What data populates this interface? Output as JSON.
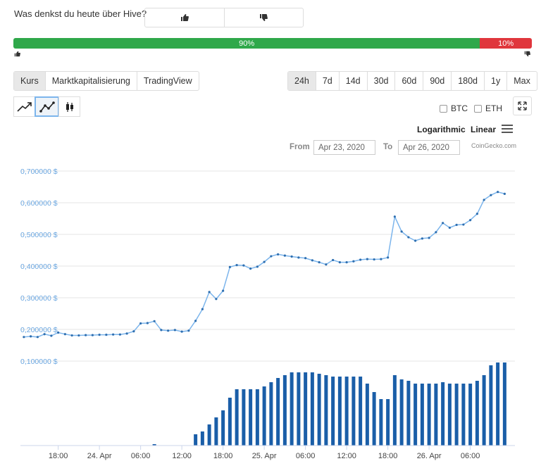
{
  "header": {
    "question": "Was denkst du heute über Hive?",
    "vote_up_icon": "thumbs-up-icon",
    "vote_down_icon": "thumbs-down-icon"
  },
  "sentiment": {
    "up_pct": 90,
    "down_pct": 10,
    "up_label": "90%",
    "down_label": "10%",
    "up_color": "#2fa84a",
    "down_color": "#e0363c"
  },
  "tabs": [
    "Kurs",
    "Marktkapitalisierung",
    "TradingView"
  ],
  "ranges": [
    "24h",
    "7d",
    "14d",
    "30d",
    "60d",
    "90d",
    "180d",
    "1y",
    "Max"
  ],
  "chart_types": [
    "line-chart-icon",
    "line-points-icon",
    "candlestick-icon"
  ],
  "compare": {
    "btc": "BTC",
    "eth": "ETH"
  },
  "scale": {
    "log": "Logarithmic",
    "linear": "Linear"
  },
  "range_inputs": {
    "from_label": "From",
    "to_label": "To",
    "from_value": "Apr 23, 2020",
    "to_value": "Apr 26, 2020"
  },
  "credit": "CoinGecko.com",
  "chart_data": {
    "type": "line",
    "line_color": "#7cb5ec",
    "bar_color": "#1a5ea8",
    "y_ticks": [
      {
        "value": 0.1,
        "label": "0,100000 $"
      },
      {
        "value": 0.2,
        "label": "0,200000 $"
      },
      {
        "value": 0.3,
        "label": "0,300000 $"
      },
      {
        "value": 0.4,
        "label": "0,400000 $"
      },
      {
        "value": 0.5,
        "label": "0,500000 $"
      },
      {
        "value": 0.6,
        "label": "0,600000 $"
      },
      {
        "value": 0.7,
        "label": "0,700000 $"
      }
    ],
    "ylim": [
      0.05,
      0.7
    ],
    "x_ticks": [
      {
        "t": 11,
        "label": "18:00"
      },
      {
        "t": 23,
        "label": "24. Apr"
      },
      {
        "t": 35,
        "label": "06:00"
      },
      {
        "t": 47,
        "label": "12:00"
      },
      {
        "t": 59,
        "label": "18:00"
      },
      {
        "t": 71,
        "label": "25. Apr"
      },
      {
        "t": 83,
        "label": "06:00"
      },
      {
        "t": 95,
        "label": "12:00"
      },
      {
        "t": 107,
        "label": "18:00"
      },
      {
        "t": 119,
        "label": "26. Apr"
      },
      {
        "t": 131,
        "label": "06:00"
      }
    ],
    "x_range": [
      0,
      144
    ],
    "price": [
      [
        1,
        0.176
      ],
      [
        3,
        0.178
      ],
      [
        5,
        0.176
      ],
      [
        7,
        0.185
      ],
      [
        9,
        0.18
      ],
      [
        11,
        0.19
      ],
      [
        13,
        0.185
      ],
      [
        15,
        0.181
      ],
      [
        17,
        0.181
      ],
      [
        19,
        0.182
      ],
      [
        21,
        0.182
      ],
      [
        23,
        0.183
      ],
      [
        25,
        0.183
      ],
      [
        27,
        0.184
      ],
      [
        29,
        0.184
      ],
      [
        31,
        0.187
      ],
      [
        33,
        0.194
      ],
      [
        35,
        0.219
      ],
      [
        37,
        0.22
      ],
      [
        39,
        0.226
      ],
      [
        41,
        0.198
      ],
      [
        43,
        0.196
      ],
      [
        45,
        0.198
      ],
      [
        47,
        0.193
      ],
      [
        49,
        0.196
      ],
      [
        51,
        0.227
      ],
      [
        53,
        0.264
      ],
      [
        55,
        0.318
      ],
      [
        57,
        0.296
      ],
      [
        59,
        0.322
      ],
      [
        61,
        0.397
      ],
      [
        63,
        0.403
      ],
      [
        65,
        0.402
      ],
      [
        67,
        0.392
      ],
      [
        69,
        0.398
      ],
      [
        71,
        0.413
      ],
      [
        73,
        0.431
      ],
      [
        75,
        0.437
      ],
      [
        77,
        0.433
      ],
      [
        79,
        0.43
      ],
      [
        81,
        0.427
      ],
      [
        83,
        0.425
      ],
      [
        85,
        0.418
      ],
      [
        87,
        0.412
      ],
      [
        89,
        0.405
      ],
      [
        91,
        0.419
      ],
      [
        93,
        0.412
      ],
      [
        95,
        0.412
      ],
      [
        97,
        0.415
      ],
      [
        99,
        0.42
      ],
      [
        101,
        0.422
      ],
      [
        103,
        0.421
      ],
      [
        105,
        0.422
      ],
      [
        107,
        0.427
      ],
      [
        109,
        0.556
      ],
      [
        111,
        0.509
      ],
      [
        113,
        0.491
      ],
      [
        115,
        0.48
      ],
      [
        117,
        0.487
      ],
      [
        119,
        0.489
      ],
      [
        121,
        0.507
      ],
      [
        123,
        0.536
      ],
      [
        125,
        0.521
      ],
      [
        127,
        0.53
      ],
      [
        129,
        0.531
      ],
      [
        131,
        0.545
      ],
      [
        133,
        0.565
      ],
      [
        135,
        0.609
      ],
      [
        137,
        0.624
      ],
      [
        139,
        0.634
      ],
      [
        141,
        0.628
      ]
    ],
    "volume": [
      [
        39,
        0.01
      ],
      [
        51,
        0.08
      ],
      [
        53,
        0.1
      ],
      [
        55,
        0.15
      ],
      [
        57,
        0.2
      ],
      [
        59,
        0.25
      ],
      [
        61,
        0.34
      ],
      [
        63,
        0.4
      ],
      [
        65,
        0.4
      ],
      [
        67,
        0.4
      ],
      [
        69,
        0.4
      ],
      [
        71,
        0.42
      ],
      [
        73,
        0.45
      ],
      [
        75,
        0.48
      ],
      [
        77,
        0.5
      ],
      [
        79,
        0.52
      ],
      [
        81,
        0.52
      ],
      [
        83,
        0.52
      ],
      [
        85,
        0.52
      ],
      [
        87,
        0.51
      ],
      [
        89,
        0.5
      ],
      [
        91,
        0.49
      ],
      [
        93,
        0.49
      ],
      [
        95,
        0.49
      ],
      [
        97,
        0.49
      ],
      [
        99,
        0.49
      ],
      [
        101,
        0.44
      ],
      [
        103,
        0.38
      ],
      [
        105,
        0.33
      ],
      [
        107,
        0.33
      ],
      [
        109,
        0.5
      ],
      [
        111,
        0.47
      ],
      [
        113,
        0.46
      ],
      [
        115,
        0.44
      ],
      [
        117,
        0.44
      ],
      [
        119,
        0.44
      ],
      [
        121,
        0.44
      ],
      [
        123,
        0.45
      ],
      [
        125,
        0.44
      ],
      [
        127,
        0.44
      ],
      [
        129,
        0.44
      ],
      [
        131,
        0.44
      ],
      [
        133,
        0.46
      ],
      [
        135,
        0.5
      ],
      [
        137,
        0.57
      ],
      [
        139,
        0.59
      ],
      [
        141,
        0.59
      ]
    ]
  }
}
